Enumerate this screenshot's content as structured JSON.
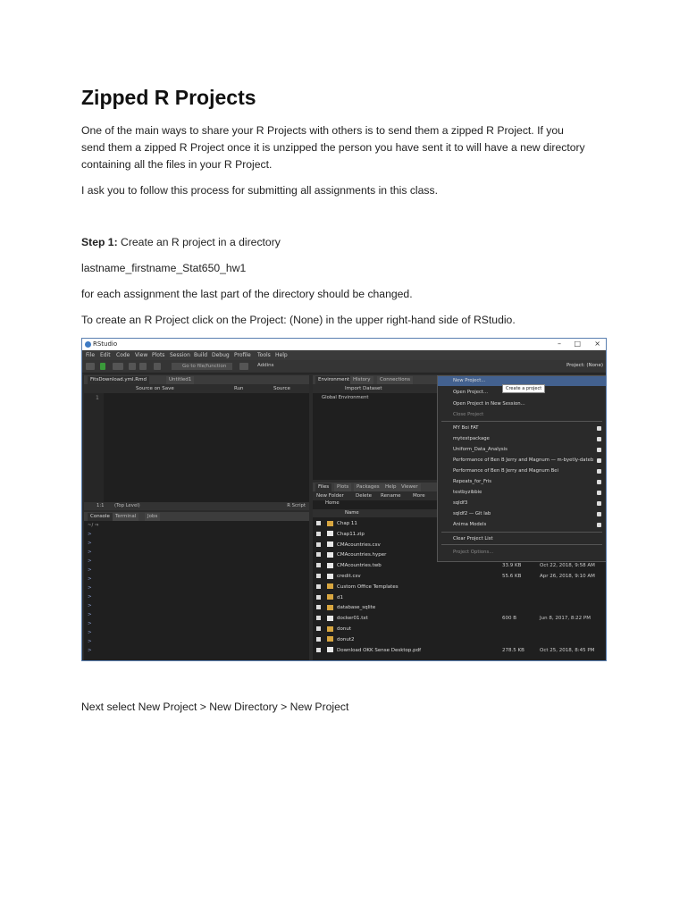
{
  "doc": {
    "title": "Zipped R Projects",
    "intro_line1": "One of the main ways to share your R Projects with others is to send them  a zipped R Project.  If you",
    "intro_line2": "send them a zipped R Project once it is unzipped the person you have sent it to will have a new directory",
    "intro_line3": "containing all the files in your R Project.",
    "ask": "I ask you to follow this process for submitting all assignments in this class.",
    "step1_label": "Step 1:",
    "step1_text": " Create an R project in a directory",
    "dirname": "lastname_firstname_Stat650_hw1",
    "each": "for each assignment the last part of the directory should be changed.",
    "create": "To create an R Project click on the Project: (None) in the upper right-hand side of RStudio.",
    "next": "Next select New Project > New Directory > New Project"
  },
  "rstudio": {
    "window_title": "RStudio",
    "menu": [
      "File",
      "Edit",
      "Code",
      "View",
      "Plots",
      "Session",
      "Build",
      "Debug",
      "Profile",
      "Tools",
      "Help"
    ],
    "goto_placeholder": "Go to file/function",
    "addins": "Addins",
    "project_button": "Project: (None)",
    "editor_tab1": "FitsDownload.yml.Rmd",
    "editor_tab2": "Untitled1",
    "source_on_save": "Source on Save",
    "run": "Run",
    "source": "Source",
    "line_number": "1",
    "status_pos": "1:1",
    "status_level": "(Top Level)",
    "status_type": "R Script",
    "console_tabs": [
      "Console",
      "Terminal",
      "Jobs"
    ],
    "console_path": "~/ ⇒",
    "env_tabs": [
      "Environment",
      "History",
      "Connections"
    ],
    "import_dataset": "Import Dataset",
    "global_env": "Global Environment",
    "files_tabs": [
      "Files",
      "Plots",
      "Packages",
      "Help",
      "Viewer"
    ],
    "files_tools": [
      "New Folder",
      "Delete",
      "Rename",
      "More"
    ],
    "home": "Home",
    "name_col": "Name",
    "files": [
      {
        "name": "Chap 11",
        "folder": true,
        "size": "",
        "date": ""
      },
      {
        "name": "Chap11.zip",
        "folder": false,
        "size": "",
        "date": ""
      },
      {
        "name": "CMAcountries.csv",
        "folder": false,
        "size": "",
        "date": ""
      },
      {
        "name": "CMAcountries.hyper",
        "folder": false,
        "size": "",
        "date": ""
      },
      {
        "name": "CMAcountries.twb",
        "folder": false,
        "size": "33.9 KB",
        "date": "Oct 22, 2018, 9:58 AM"
      },
      {
        "name": "credit.csv",
        "folder": false,
        "size": "55.6 KB",
        "date": "Apr 26, 2018, 9:10 AM"
      },
      {
        "name": "Custom Office Templates",
        "folder": true,
        "size": "",
        "date": ""
      },
      {
        "name": "d1",
        "folder": true,
        "size": "",
        "date": ""
      },
      {
        "name": "database_sqlite",
        "folder": true,
        "size": "",
        "date": ""
      },
      {
        "name": "docker01.txt",
        "folder": false,
        "size": "600 B",
        "date": "Jun 8, 2017, 8:22 PM"
      },
      {
        "name": "donut",
        "folder": true,
        "size": "",
        "date": ""
      },
      {
        "name": "donut2",
        "folder": true,
        "size": "",
        "date": ""
      },
      {
        "name": "Download OKK Sense Desktop.pdf",
        "folder": false,
        "size": "278.5 KB",
        "date": "Oct 25, 2018, 8:45 PM"
      }
    ],
    "dropdown": [
      {
        "label": "New Project...",
        "kind": "sel",
        "lock": false
      },
      {
        "label": "Open Project...",
        "kind": "",
        "lock": false
      },
      {
        "label": "Open Project in New Session...",
        "kind": "",
        "lock": false
      },
      {
        "label": "Close Project",
        "kind": "dim",
        "lock": false
      },
      {
        "label": "MY Boi FAT",
        "kind": "",
        "lock": true
      },
      {
        "label": "mytestpackage",
        "kind": "",
        "lock": true
      },
      {
        "label": "Uniform_Data_Analysis",
        "kind": "",
        "lock": true
      },
      {
        "label": "Performance of Ben B Jerry and Magnum — m-byetly-dateb",
        "kind": "",
        "lock": true
      },
      {
        "label": "Performance of Ben B Jerry and Magnum    Bei",
        "kind": "",
        "lock": true
      },
      {
        "label": "Repeats_for_Fris",
        "kind": "",
        "lock": true
      },
      {
        "label": "testbyzibbie",
        "kind": "",
        "lock": true
      },
      {
        "label": "sqldf3",
        "kind": "",
        "lock": true
      },
      {
        "label": "sqldf2 — Git lab",
        "kind": "",
        "lock": true
      },
      {
        "label": "Anima Models",
        "kind": "",
        "lock": true
      },
      {
        "label": "Clear Project List",
        "kind": "",
        "lock": false
      },
      {
        "label": "Project Options...",
        "kind": "dim",
        "lock": false
      }
    ],
    "tooltip": "Create a project"
  }
}
